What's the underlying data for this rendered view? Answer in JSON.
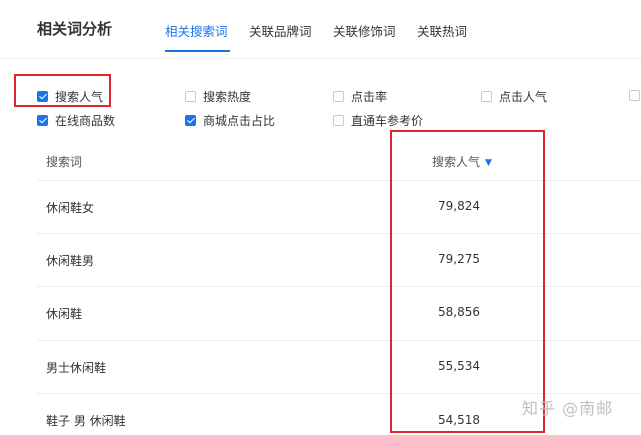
{
  "header": {
    "title": "相关词分析",
    "tabs": [
      {
        "label": "相关搜索词",
        "active": true
      },
      {
        "label": "关联品牌词",
        "active": false
      },
      {
        "label": "关联修饰词",
        "active": false
      },
      {
        "label": "关联热词",
        "active": false
      }
    ]
  },
  "options": [
    {
      "label": "搜索人气",
      "checked": true
    },
    {
      "label": "搜索热度",
      "checked": false
    },
    {
      "label": "点击率",
      "checked": false
    },
    {
      "label": "点击人气",
      "checked": false
    },
    {
      "label": "在线商品数",
      "checked": true
    },
    {
      "label": "商城点击占比",
      "checked": true
    },
    {
      "label": "直通车参考价",
      "checked": false
    }
  ],
  "table": {
    "columns": [
      "搜索词",
      "搜索人气"
    ],
    "rows": [
      {
        "term": "休闲鞋女",
        "value": "79,824"
      },
      {
        "term": "休闲鞋男",
        "value": "79,275"
      },
      {
        "term": "休闲鞋",
        "value": "58,856"
      },
      {
        "term": "男士休闲鞋",
        "value": "55,534"
      },
      {
        "term": "鞋子 男 休闲鞋",
        "value": "54,518"
      }
    ]
  },
  "watermark": "知乎 @南邮",
  "colors": {
    "accent": "#1a73e8",
    "highlight": "#e0262c"
  }
}
